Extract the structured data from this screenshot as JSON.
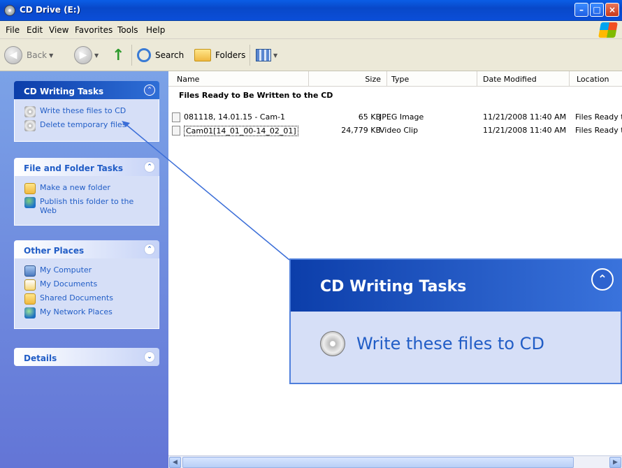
{
  "window": {
    "title": "CD Drive (E:)"
  },
  "menu": [
    "File",
    "Edit",
    "View",
    "Favorites",
    "Tools",
    "Help"
  ],
  "toolbar": {
    "back": "Back",
    "search": "Search",
    "folders": "Folders"
  },
  "tasks_pane": {
    "cd_writing": {
      "title": "CD Writing Tasks",
      "items": [
        "Write these files to CD",
        "Delete temporary files"
      ]
    },
    "file_folder": {
      "title": "File and Folder Tasks",
      "items": [
        "Make a new folder",
        "Publish this folder to the Web"
      ]
    },
    "other_places": {
      "title": "Other Places",
      "items": [
        "My Computer",
        "My Documents",
        "Shared Documents",
        "My Network Places"
      ]
    },
    "details": {
      "title": "Details"
    }
  },
  "file_list": {
    "columns": [
      "Name",
      "Size",
      "Type",
      "Date Modified",
      "Location"
    ],
    "group_title": "Files Ready to Be Written to the CD",
    "rows": [
      {
        "name": "081118, 14.01.15 - Cam-1",
        "size": "65 KB",
        "type": "JPEG Image",
        "date": "11/21/2008 11:40 AM",
        "location": "Files Ready t"
      },
      {
        "name": "Cam01[14_01_00-14_02_01]",
        "size": "24,779 KB",
        "type": "Video Clip",
        "date": "11/21/2008 11:40 AM",
        "location": "Files Ready t"
      }
    ]
  },
  "zoom_callout": {
    "title": "CD Writing Tasks",
    "task": "Write these files to CD"
  },
  "colors": {
    "titlebar": "#0b4ed8",
    "task_pane": "#6f8ee0",
    "link": "#215dc6",
    "callout_line": "#3b6ed8"
  }
}
